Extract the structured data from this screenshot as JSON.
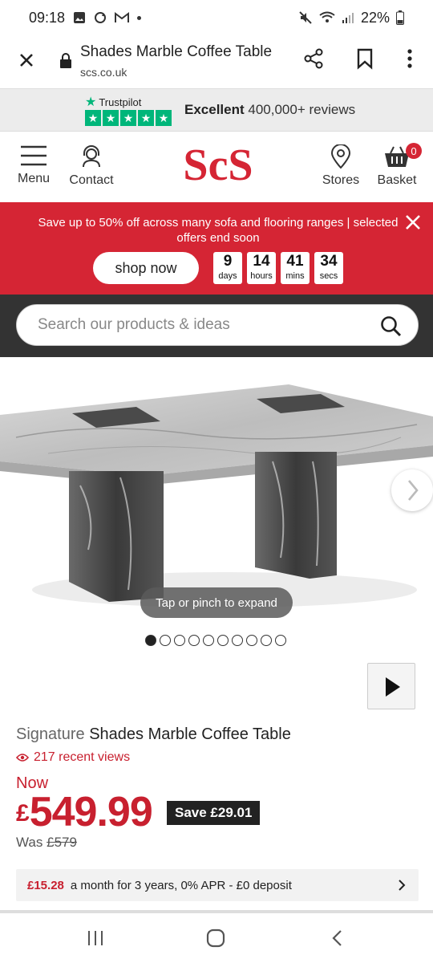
{
  "status_bar": {
    "time": "09:18",
    "battery": "22%"
  },
  "browser": {
    "title": "Shades Marble Coffee Table",
    "url": "scs.co.uk"
  },
  "trustpilot": {
    "brand": "Trustpilot",
    "rating_word": "Excellent",
    "reviews": "400,000+ reviews"
  },
  "header": {
    "menu_label": "Menu",
    "contact_label": "Contact",
    "logo_text": "ScS",
    "stores_label": "Stores",
    "basket_label": "Basket",
    "basket_count": "0",
    "brand_color": "#d52534"
  },
  "promo": {
    "text": "Save up to 50% off across many sofa and flooring ranges | selected offers end soon",
    "shop_now": "shop now",
    "countdown": [
      {
        "value": "9",
        "unit": "days"
      },
      {
        "value": "14",
        "unit": "hours"
      },
      {
        "value": "41",
        "unit": "mins"
      },
      {
        "value": "34",
        "unit": "secs"
      }
    ]
  },
  "search": {
    "placeholder": "Search our products & ideas"
  },
  "gallery": {
    "tap_hint": "Tap or pinch to expand",
    "image_count": 10,
    "active_index": 0
  },
  "product": {
    "brand": "Signature",
    "name": "Shades Marble Coffee Table",
    "views": "217 recent views",
    "now_label": "Now",
    "currency": "£",
    "price": "549.99",
    "save": "Save £29.01",
    "was_label": "Was",
    "was_price": "£579",
    "finance_amount": "£15.28",
    "finance_text": "a month for 3 years, 0% APR - £0 deposit"
  }
}
